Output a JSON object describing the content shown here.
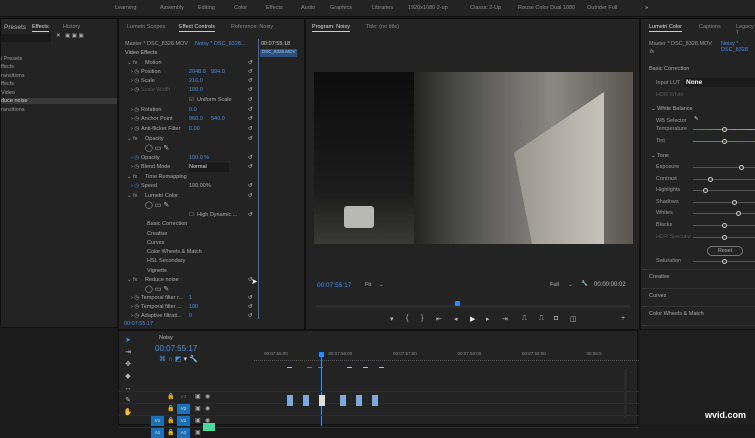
{
  "workspaces": [
    "Learning",
    "Assembly",
    "Editing",
    "Color",
    "Effects",
    "Audio",
    "Graphics",
    "Libraries",
    "1920x1080 2-up",
    "Classic 2-Up",
    "Rouse Color Dual 1080",
    "Outrider Full"
  ],
  "effects_panel": {
    "tabs": [
      "Presets",
      "Effects",
      "History"
    ],
    "items": [
      "",
      "i Presets",
      "ffects",
      "ransitions",
      "ffects",
      "Video",
      "duce noise",
      "ransitions"
    ]
  },
  "effect_controls": {
    "tabs": [
      "Lumetri Scopes",
      "Effect Controls",
      "Reference: Noisy"
    ],
    "master": "Master * DSC_8328.MOV",
    "clip": "Noisy * DSC_8328...",
    "mini_timecode": "00:07:55:18",
    "mini_clip": "DSC_8328.MOV",
    "section": "Video Effects",
    "rows": [
      {
        "label": "Motion",
        "v1": "",
        "v2": ""
      },
      {
        "label": "Position",
        "v1": "2048.0",
        "v2": "994.0"
      },
      {
        "label": "Scale",
        "v1": "216.0",
        "v2": ""
      },
      {
        "label": "Scale Width",
        "v1": "100.0",
        "v2": ""
      },
      {
        "label": "Uniform Scale",
        "v1": "",
        "v2": ""
      },
      {
        "label": "Rotation",
        "v1": "0.0",
        "v2": ""
      },
      {
        "label": "Anchor Point",
        "v1": "960.0",
        "v2": "540.0"
      },
      {
        "label": "Anti-flicker Filter",
        "v1": "0.00",
        "v2": ""
      },
      {
        "label": "Opacity",
        "v1": "",
        "v2": ""
      },
      {
        "label": "Opacity",
        "v1": "100.0 %",
        "v2": ""
      },
      {
        "label": "Blend Mode",
        "v1": "Normal",
        "v2": ""
      },
      {
        "label": "Time Remapping",
        "v1": "",
        "v2": ""
      },
      {
        "label": "Speed",
        "v1": "100.00%",
        "v2": ""
      },
      {
        "label": "Lumetri Color",
        "v1": "",
        "v2": ""
      },
      {
        "label": "High Dynamic ...",
        "v1": "",
        "v2": ""
      },
      {
        "label": "Basic Correction",
        "v1": "",
        "v2": ""
      },
      {
        "label": "Creative",
        "v1": "",
        "v2": ""
      },
      {
        "label": "Curves",
        "v1": "",
        "v2": ""
      },
      {
        "label": "Color Wheels & Match",
        "v1": "",
        "v2": ""
      },
      {
        "label": "HSL Secondary",
        "v1": "",
        "v2": ""
      },
      {
        "label": "Vignette",
        "v1": "",
        "v2": ""
      },
      {
        "label": "Reduce noise",
        "v1": "",
        "v2": ""
      },
      {
        "label": "Temporal filter r...",
        "v1": "1",
        "v2": ""
      },
      {
        "label": "Temporal filter ...",
        "v1": "100",
        "v2": ""
      },
      {
        "label": "Adaptive filtrati...",
        "v1": "0",
        "v2": ""
      }
    ],
    "timecode": "00:07:55:17"
  },
  "program": {
    "tab": "Program: Noisy",
    "title_tab": "Title: (no title)",
    "timecode": "00:07:55:17",
    "fit": "Fit",
    "quality": "Full",
    "duration": "00:00:00:02",
    "playhead": 0.44
  },
  "lumetri": {
    "tabs": [
      "Lumetri Color",
      "Captions",
      "Legacy T"
    ],
    "master": "Master * DSC_8328.MOV",
    "clip": "Noisy * DSC_8328",
    "basic": "Basic Correction",
    "input_lut_label": "Input LUT",
    "input_lut": "None",
    "hdr_white": "HDR White",
    "white_balance": "White Balance",
    "wb_selector": "WB Selector",
    "tone": "Tone",
    "reset": "Reset",
    "sliders": [
      {
        "label": "Temperature",
        "value": 0.5
      },
      {
        "label": "Tint",
        "value": 0.5
      },
      {
        "label": "Exposure",
        "value": 0.78
      },
      {
        "label": "Contrast",
        "value": 0.27
      },
      {
        "label": "Highlights",
        "value": 0.2
      },
      {
        "label": "Shadows",
        "value": 0.66
      },
      {
        "label": "Whites",
        "value": 0.72
      },
      {
        "label": "Blacks",
        "value": 0.5
      },
      {
        "label": "HDR Specular",
        "value": 0.5
      },
      {
        "label": "Saturation",
        "value": 0.5
      }
    ],
    "sections": [
      "Creative",
      "Curves",
      "Color Wheels & Match",
      "HSL Secondary",
      "Vignette"
    ]
  },
  "timeline": {
    "tab": "Noisy",
    "timecode": "00:07:55:17",
    "ruler": [
      "00:07:55:00",
      "00:07:56:00",
      "00:07:57:00",
      "00:07:58:00",
      "00:07:59:00",
      "00:08:0"
    ],
    "tracks": [
      "V3",
      "V2",
      "V1",
      "A1"
    ]
  },
  "watermark": "wvid.com"
}
